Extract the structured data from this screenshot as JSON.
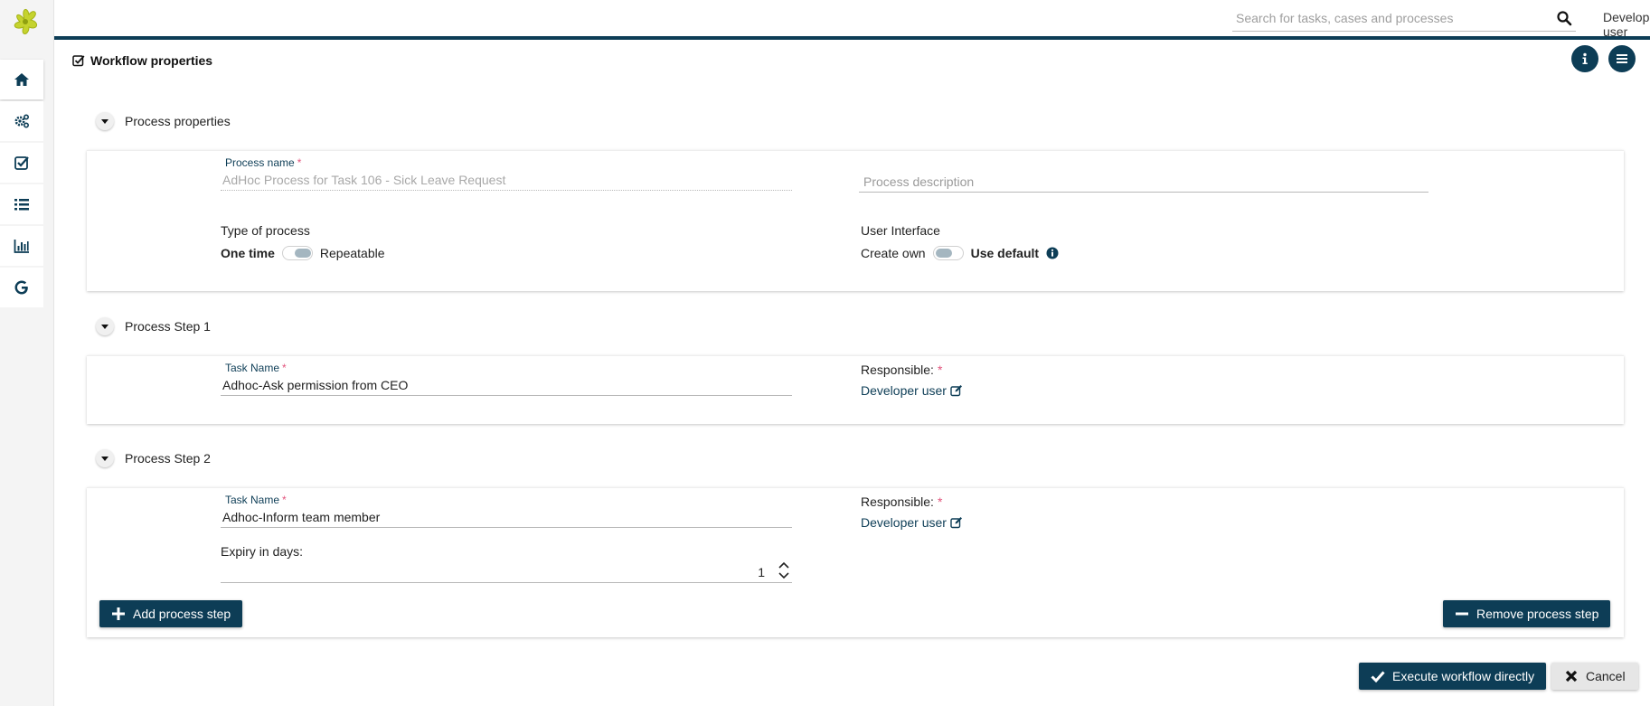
{
  "topbar": {
    "search_placeholder": "Search for tasks, cases and processes",
    "user_name": "Developer user"
  },
  "sidebar": {
    "items": [
      {
        "icon": "home-icon"
      },
      {
        "icon": "cogs-icon"
      },
      {
        "icon": "check-square-icon"
      },
      {
        "icon": "list-icon"
      },
      {
        "icon": "bar-chart-icon"
      },
      {
        "icon": "google-icon"
      }
    ]
  },
  "page": {
    "title": "Workflow properties"
  },
  "process_properties": {
    "header": "Process properties",
    "process_name_label": "Process name",
    "process_name_value": "AdHoc Process for Task 106 - Sick Leave Request",
    "process_description_placeholder": "Process description",
    "type_of_process_label": "Type of process",
    "type_option_left": "One time",
    "type_option_right": "Repeatable",
    "ui_label": "User Interface",
    "ui_option_left": "Create own",
    "ui_option_right": "Use default"
  },
  "steps": [
    {
      "header": "Process Step 1",
      "task_name_label": "Task Name",
      "task_name_value": "Adhoc-Ask permission from CEO",
      "responsible_label": "Responsible:",
      "responsible_value": "Developer user"
    },
    {
      "header": "Process Step 2",
      "task_name_label": "Task Name",
      "task_name_value": "Adhoc-Inform team member",
      "responsible_label": "Responsible:",
      "responsible_value": "Developer user",
      "expiry_label": "Expiry in days:",
      "expiry_value": "1"
    }
  ],
  "buttons": {
    "add_step": "Add process step",
    "remove_step": "Remove process step",
    "execute": "Execute workflow directly",
    "cancel": "Cancel"
  },
  "required_marker": "*",
  "colors": {
    "primary": "#0d3d56",
    "required": "#e2557d",
    "logo": "#c5d32e"
  }
}
